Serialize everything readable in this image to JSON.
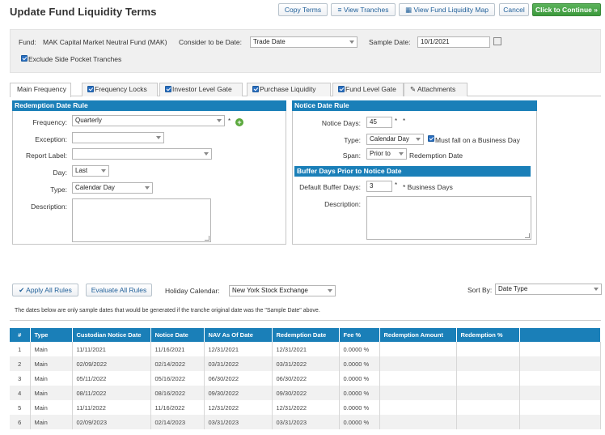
{
  "page": {
    "title": "Update Fund Liquidity Terms"
  },
  "toolbar": {
    "copy_terms": "Copy Terms",
    "view_tranches": "View Tranches",
    "view_map": "View Fund Liquidity Map",
    "cancel": "Cancel",
    "continue": "Click to Continue »"
  },
  "fund": {
    "fund_label": "Fund:",
    "fund_name": "MAK Capital Market Neutral Fund (MAK)",
    "consider_label": "Consider to be Date:",
    "consider_value": "Trade Date",
    "sample_label": "Sample Date:",
    "sample_value": "10/1/2021",
    "exclude_label": "Exclude Side Pocket Tranches"
  },
  "tabs": [
    {
      "label": "Main Frequency",
      "checked": false
    },
    {
      "label": "Frequency Locks",
      "checked": true
    },
    {
      "label": "Investor Level Gate",
      "checked": true
    },
    {
      "label": "Purchase Liquidity",
      "checked": true
    },
    {
      "label": "Fund Level Gate",
      "checked": true
    },
    {
      "label": "Attachments",
      "checked": false
    }
  ],
  "redemption": {
    "header": "Redemption Date Rule",
    "frequency_label": "Frequency:",
    "frequency_value": "Quarterly",
    "exception_label": "Exception:",
    "exception_value": "",
    "report_label": "Report Label:",
    "report_value": "",
    "day_label": "Day:",
    "day_value": "Last",
    "type_label": "Type:",
    "type_value": "Calendar Day",
    "description_label": "Description:"
  },
  "notice": {
    "header": "Notice Date Rule",
    "days_label": "Notice Days:",
    "days_value": "45",
    "type_label": "Type:",
    "type_value": "Calendar Day",
    "business_day_label": "Must fall on a Business Day",
    "span_label": "Span:",
    "span_value": "Prior to",
    "span_suffix": "Redemption Date"
  },
  "buffer": {
    "header": "Buffer Days Prior to Notice Date",
    "default_label": "Default Buffer Days:",
    "default_value": "3",
    "suffix": "* Business Days",
    "description_label": "Description:"
  },
  "rules": {
    "apply_all": "Apply All Rules",
    "evaluate_all": "Evaluate All Rules",
    "holiday_label": "Holiday Calendar:",
    "holiday_value": "New York Stock Exchange",
    "sortby_label": "Sort By:",
    "sortby_value": "Date Type",
    "note": "The dates below are only sample dates that would be generated if the tranche original date was the \"Sample Date\" above."
  },
  "table": {
    "columns": [
      "#",
      "Type",
      "Custodian Notice Date",
      "Notice Date",
      "NAV As Of Date",
      "Redemption Date",
      "Fee %",
      "Redemption Amount",
      "Redemption %"
    ],
    "rows": [
      [
        "1",
        "Main",
        "11/11/2021",
        "11/16/2021",
        "12/31/2021",
        "12/31/2021",
        "0.0000 %",
        "",
        ""
      ],
      [
        "2",
        "Main",
        "02/09/2022",
        "02/14/2022",
        "03/31/2022",
        "03/31/2022",
        "0.0000 %",
        "",
        ""
      ],
      [
        "3",
        "Main",
        "05/11/2022",
        "05/16/2022",
        "06/30/2022",
        "06/30/2022",
        "0.0000 %",
        "",
        ""
      ],
      [
        "4",
        "Main",
        "08/11/2022",
        "08/16/2022",
        "09/30/2022",
        "09/30/2022",
        "0.0000 %",
        "",
        ""
      ],
      [
        "5",
        "Main",
        "11/11/2022",
        "11/16/2022",
        "12/31/2022",
        "12/31/2022",
        "0.0000 %",
        "",
        ""
      ],
      [
        "6",
        "Main",
        "02/09/2023",
        "02/14/2023",
        "03/31/2023",
        "03/31/2023",
        "0.0000 %",
        "",
        ""
      ]
    ]
  },
  "colors": {
    "header_blue": "#1a7fb8",
    "continue_green": "#4aa64a",
    "link_blue": "#1f5f99"
  }
}
